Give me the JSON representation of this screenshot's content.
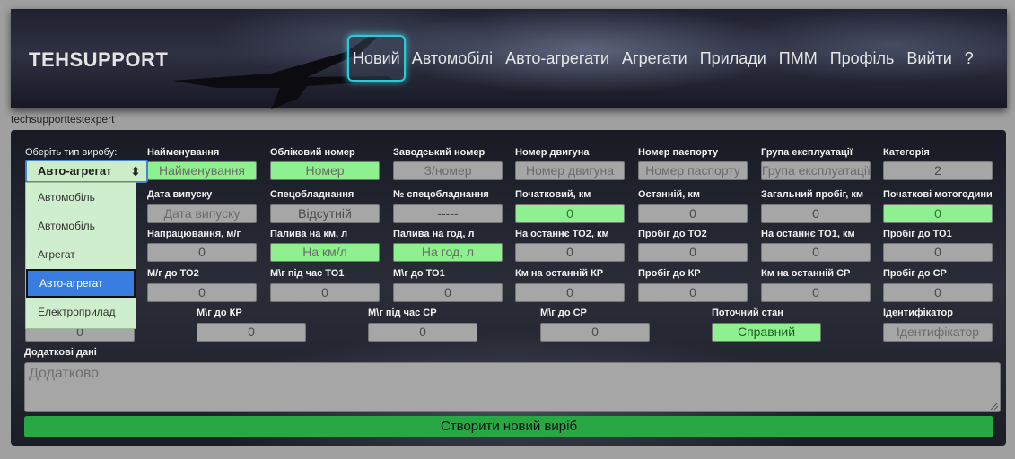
{
  "header": {
    "brand": "TEHSUPPORT",
    "nav": [
      "Новий",
      "Автомобілі",
      "Авто-агрегати",
      "Агрегати",
      "Прилади",
      "ПММ",
      "Профіль",
      "Вийти",
      "?"
    ],
    "active_nav": "Новий"
  },
  "user": {
    "username": "techsupporttestexpert"
  },
  "form": {
    "type_label": "Оберіть тип виробу:",
    "type_selected": "Авто-агрегат",
    "type_options": [
      "Автомобіль",
      "Автомобіль",
      "Агрегат",
      "Авто-агрегат",
      "Електроприлад"
    ],
    "fields": {
      "name": {
        "label": "Найменування",
        "placeholder": "Найменування"
      },
      "reg_number": {
        "label": "Обліковий номер",
        "placeholder": "Номер"
      },
      "factory_number": {
        "label": "Заводський номер",
        "placeholder": "З/номер"
      },
      "engine_number": {
        "label": "Номер двигуна",
        "placeholder": "Номер двигуна"
      },
      "passport_number": {
        "label": "Номер паспорту",
        "placeholder": "Номер паспорту"
      },
      "operation_group": {
        "label": "Група експлуатації",
        "placeholder": "Група експлуатації"
      },
      "category": {
        "label": "Категорія",
        "value": "2"
      },
      "release_date": {
        "label": "Дата випуску",
        "placeholder": "Дата випуску"
      },
      "special_equipment": {
        "label": "Спецобладнання",
        "value": "Відсутній"
      },
      "special_equipment_number": {
        "label": "№ спецобладнання",
        "value": "-----"
      },
      "initial_km": {
        "label": "Початковий, км",
        "value": "0"
      },
      "last_km": {
        "label": "Останній, км",
        "value": "0"
      },
      "total_mileage": {
        "label": "Загальний пробіг, км",
        "value": "0"
      },
      "initial_motohours": {
        "label": "Початкові мотогодини",
        "value": "0"
      },
      "worked_hours": {
        "label": "Напрацювання, м/г",
        "value": "0"
      },
      "fuel_per_km": {
        "label": "Палива на км, л",
        "placeholder": "На км/л"
      },
      "fuel_per_hour": {
        "label": "Палива на год, л",
        "placeholder": "На год, л"
      },
      "last_to2": {
        "label": "На останнє ТО2, км",
        "value": "0"
      },
      "mileage_to_to2": {
        "label": "Пробіг до ТО2",
        "value": "0"
      },
      "last_to1": {
        "label": "На останнє ТО1, км",
        "value": "0"
      },
      "mileage_to_to1": {
        "label": "Пробіг до ТО1",
        "value": "0"
      },
      "mh_to_to2": {
        "label": "М/г до ТО2",
        "value": "0"
      },
      "mh_during_to1": {
        "label": "М\\г під час ТО1",
        "value": "0"
      },
      "mh_to_to1": {
        "label": "М\\г до ТО1",
        "value": "0"
      },
      "km_last_kr": {
        "label": "Км на останній КР",
        "value": "0"
      },
      "mileage_to_kr": {
        "label": "Пробіг до КР",
        "value": "0"
      },
      "km_last_sr": {
        "label": "Км на останній СР",
        "value": "0"
      },
      "mileage_to_sr": {
        "label": "Пробіг до СР",
        "value": "0"
      },
      "mh_hidden": {
        "value": "0"
      },
      "mh_to_kr": {
        "label": "М\\г до КР",
        "value": "0"
      },
      "mh_during_sr": {
        "label": "М\\г під час СР",
        "value": "0"
      },
      "mh_to_sr": {
        "label": "М\\г до СР",
        "value": "0"
      },
      "current_state": {
        "label": "Поточний стан",
        "value": "Справний"
      },
      "identifier": {
        "label": "Ідентифікатор",
        "placeholder": "Ідентифікатор"
      }
    },
    "additional_label": "Додаткові дані",
    "additional_placeholder": "Додатково",
    "create_button": "Створити новий виріб"
  },
  "colors": {
    "accent_green": "#8ef08e",
    "button_green": "#28a745",
    "nav_highlight": "#2fc8d8",
    "select_blue": "#3a7de0"
  }
}
